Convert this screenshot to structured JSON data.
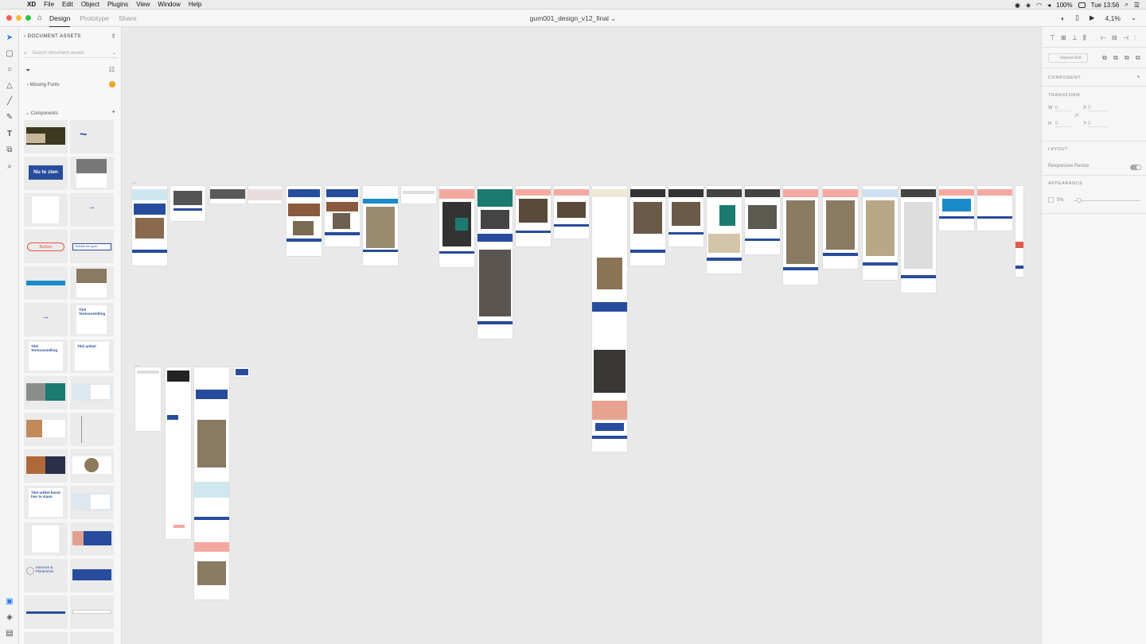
{
  "menubar": {
    "apple": "",
    "app": "XD",
    "items": [
      "File",
      "Edit",
      "Object",
      "Plugins",
      "View",
      "Window",
      "Help"
    ],
    "battery": "100%",
    "clock": "Tue 13:56"
  },
  "titlebar": {
    "tabs": [
      "Design",
      "Prototype",
      "Share"
    ],
    "doc_title": "gum001_design_v12_final",
    "zoom": "4,1%"
  },
  "assets": {
    "header": "DOCUMENT ASSETS",
    "search_placeholder": "Search document assets",
    "missing_fonts": "Missing Fonts",
    "components_label": "Components",
    "thumbs": {
      "nu_te_zien": "Nu te zien",
      "button": "Button",
      "arrow": "→",
      "wave": "~",
      "titel_tentoonstelling": "Titel Tentoonstelling",
      "titel_artikel": "Titel artikel",
      "museum": "Museum & Plantentuin",
      "ontdek": "Ontdek het gum",
      "titel_artikel_lang": "Titel artikel kunst hier te staan"
    }
  },
  "props": {
    "component": "COMPONENT",
    "transform": "TRANSFORM",
    "w": "W",
    "w_val": "0",
    "h": "H",
    "h_val": "0",
    "x": "X",
    "x_val": "0",
    "y": "Y",
    "y_val": "0",
    "layout": "LAYOUT",
    "responsive": "Responsive Resize",
    "appearance": "APPEARANCE",
    "opacity": "0%",
    "repeat_grid": "Repeat Grid"
  },
  "colors": {
    "brand_blue": "#284c9d",
    "salmon": "#f4a9a0",
    "teal": "#1c7a70",
    "dark": "#333333"
  }
}
